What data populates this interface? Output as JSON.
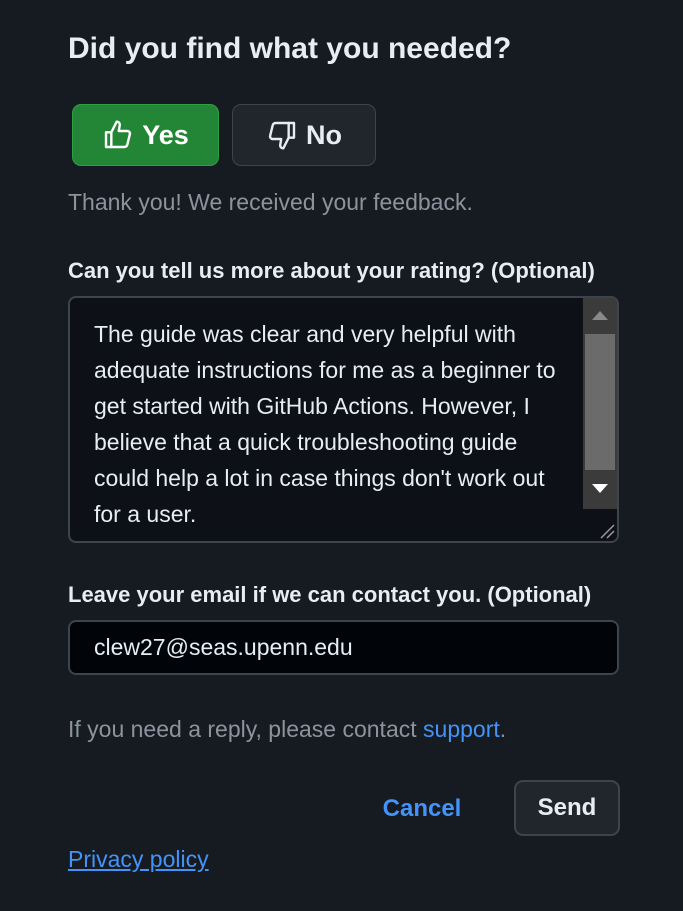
{
  "feedback": {
    "heading": "Did you find what you needed?",
    "yes_label": "Yes",
    "no_label": "No",
    "thanks_message": "Thank you! We received your feedback.",
    "rating_label": "Can you tell us more about your rating? (Optional)",
    "rating_text": "The guide was clear and very helpful with adequate instructions for me as a beginner to get started with GitHub Actions. However, I believe that a quick troubleshooting guide could help a lot in case things don't work out for a user.",
    "email_label": "Leave your email if we can contact you. (Optional)",
    "email_value": "clew27@seas.upenn.edu",
    "reply_note_prefix": "If you need a reply, please contact ",
    "support_link": "support",
    "reply_note_suffix": ".",
    "cancel_label": "Cancel",
    "send_label": "Send",
    "privacy_link": "Privacy policy"
  },
  "icons": {
    "yes_icon": "thumbs-up-icon",
    "no_icon": "thumbs-down-icon"
  },
  "colors": {
    "background": "#161b22",
    "yes_button": "#238636",
    "link": "#4493f8",
    "muted_text": "#8b949e"
  }
}
